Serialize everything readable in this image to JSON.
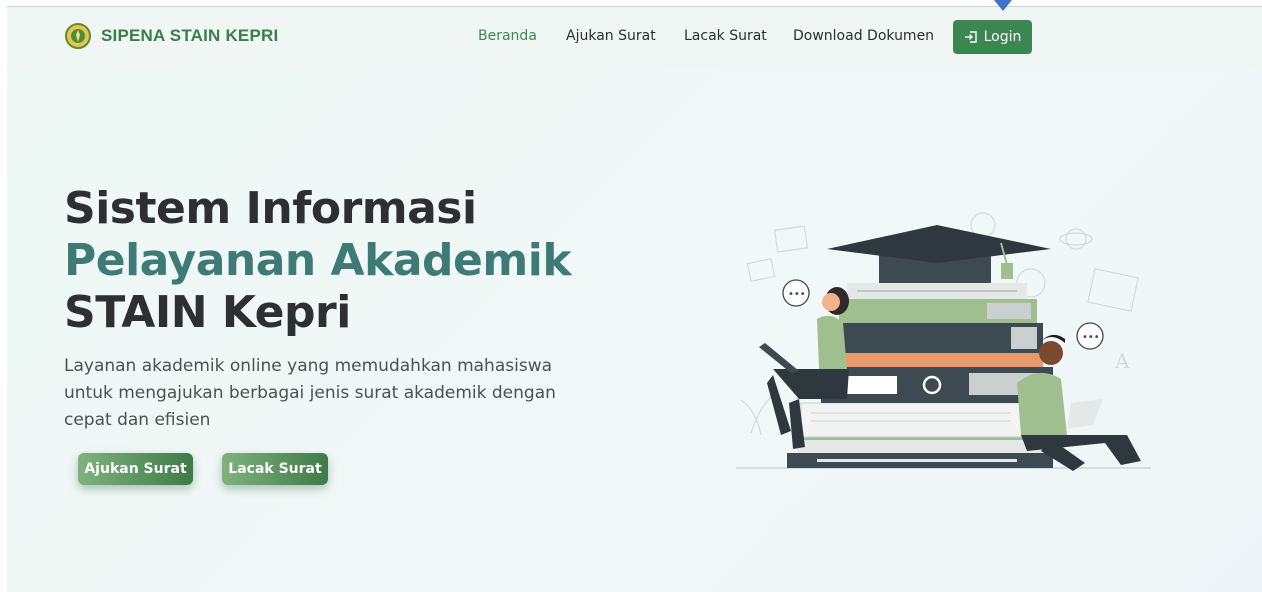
{
  "brand": {
    "name": "SIPENA STAIN KEPRI",
    "logo_icon": "institution-seal-icon"
  },
  "nav": {
    "items": [
      {
        "label": "Beranda",
        "active": true
      },
      {
        "label": "Ajukan Surat",
        "active": false
      },
      {
        "label": "Lacak Surat",
        "active": false
      },
      {
        "label": "Download Dokumen",
        "active": false
      }
    ],
    "login": {
      "label": "Login",
      "icon": "login-icon"
    }
  },
  "hero": {
    "title_line1": "Sistem Informasi",
    "title_line2": "Pelayanan Akademik",
    "title_line3": "STAIN Kepri",
    "description": "Layanan akademik online yang memudahkan mahasiswa untuk mengajukan berbagai jenis surat akademik dengan cepat dan efisien",
    "primary_button": "Ajukan Surat",
    "secondary_button": "Lacak Surat"
  },
  "colors": {
    "brand": "#3a7e4a",
    "accent_title": "#3e7b76",
    "button_start": "#7fb27e",
    "button_end": "#3e7a48"
  }
}
